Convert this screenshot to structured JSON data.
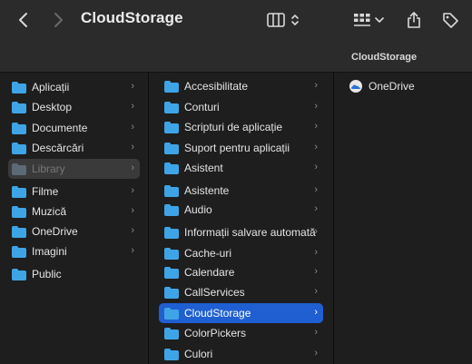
{
  "window": {
    "title": "CloudStorage"
  },
  "path_header": "CloudStorage",
  "icons": {
    "back": "chevron-left-icon",
    "forward": "chevron-right-icon",
    "view": "column-view-icon",
    "group": "grid-icon",
    "share": "share-icon",
    "tag": "tag-icon"
  },
  "accent": "#1f5fd1",
  "folder_color": "#3fa4e6",
  "column1": [
    {
      "label": "Aplicații"
    },
    {
      "label": "Desktop"
    },
    {
      "label": "Documente"
    },
    {
      "label": "Descărcări"
    },
    {
      "label": "Library"
    },
    {
      "label": "Filme"
    },
    {
      "label": "Muzică"
    },
    {
      "label": "OneDrive"
    },
    {
      "label": "Imagini"
    },
    {
      "label": "Public"
    }
  ],
  "column2": [
    {
      "label": "Accesibilitate"
    },
    {
      "label": "Conturi"
    },
    {
      "label": "Scripturi de aplicație"
    },
    {
      "label": "Suport pentru aplicații"
    },
    {
      "label": "Asistent"
    },
    {
      "label": "Asistente"
    },
    {
      "label": "Audio"
    },
    {
      "label": "Informații salvare automată"
    },
    {
      "label": "Cache-uri"
    },
    {
      "label": "Calendare"
    },
    {
      "label": "CallServices"
    },
    {
      "label": "CloudStorage"
    },
    {
      "label": "ColorPickers"
    },
    {
      "label": "Culori"
    }
  ],
  "column3": [
    {
      "label": "OneDrive"
    }
  ]
}
